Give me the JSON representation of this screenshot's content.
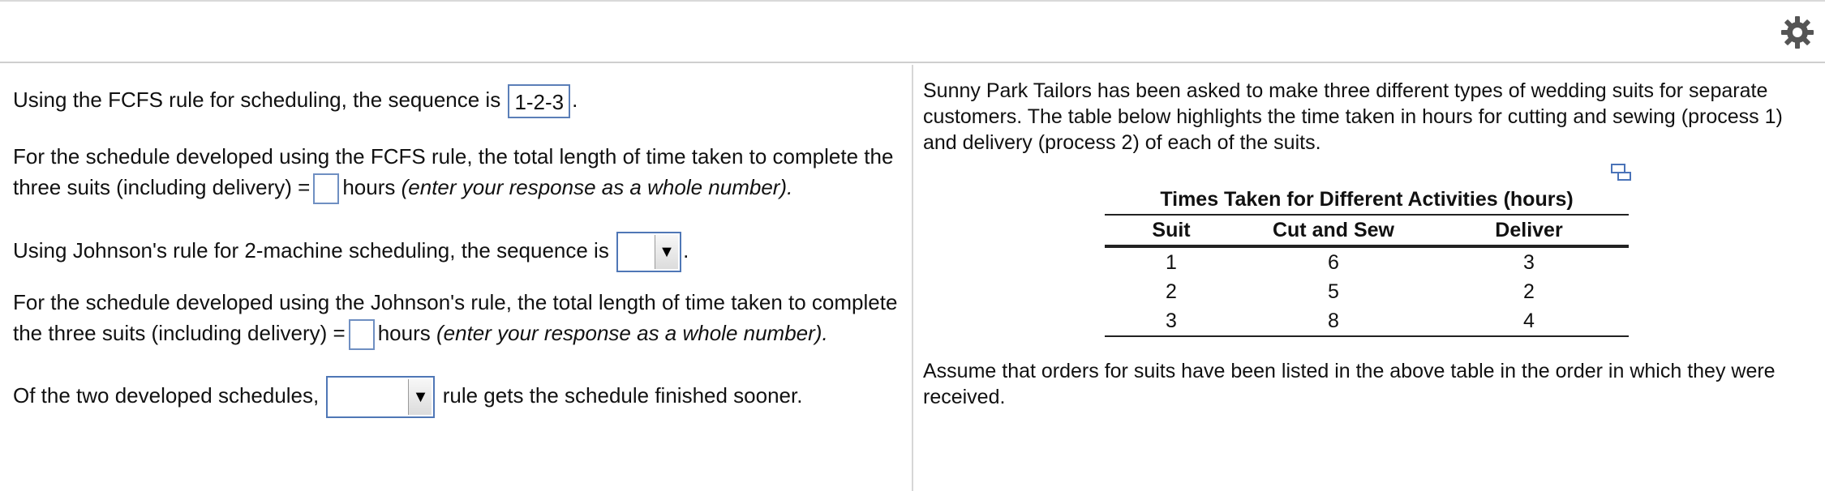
{
  "header": {
    "settings_icon": "gear-icon"
  },
  "left": {
    "q1_pre": "Using the FCFS rule for scheduling, the sequence is",
    "q1_answer": "1-2-3",
    "q1_post": ".",
    "q2_line1": "For the schedule developed using the FCFS rule, the total length of time taken to complete the",
    "q2_line2_pre": "three suits (including delivery) =",
    "q2_hours": "hours",
    "q2_hint": "(enter your response as a whole number).",
    "q3_pre": "Using Johnson's rule for 2-machine scheduling, the sequence is",
    "q3_post": ".",
    "q4_line1": "For the schedule developed using the Johnson's rule, the total length of time taken to complete",
    "q4_line2_pre": "the three suits (including delivery) =",
    "q4_hours": "hours",
    "q4_hint": "(enter your response as a whole number).",
    "q5_pre": "Of the two developed schedules,",
    "q5_post": "rule gets the schedule finished sooner."
  },
  "right": {
    "intro": "Sunny Park Tailors has been asked to make three different types of wedding suits for separate customers. The table below highlights the time taken in hours for cutting and sewing (process 1) and delivery (process 2) of each of the suits.",
    "table_title": "Times Taken for Different Activities (hours)",
    "columns": [
      "Suit",
      "Cut and Sew",
      "Deliver"
    ],
    "rows": [
      [
        "1",
        "6",
        "3"
      ],
      [
        "2",
        "5",
        "2"
      ],
      [
        "3",
        "8",
        "4"
      ]
    ],
    "footer": "Assume that orders for suits have been listed in the above table in the order in which they were received."
  }
}
